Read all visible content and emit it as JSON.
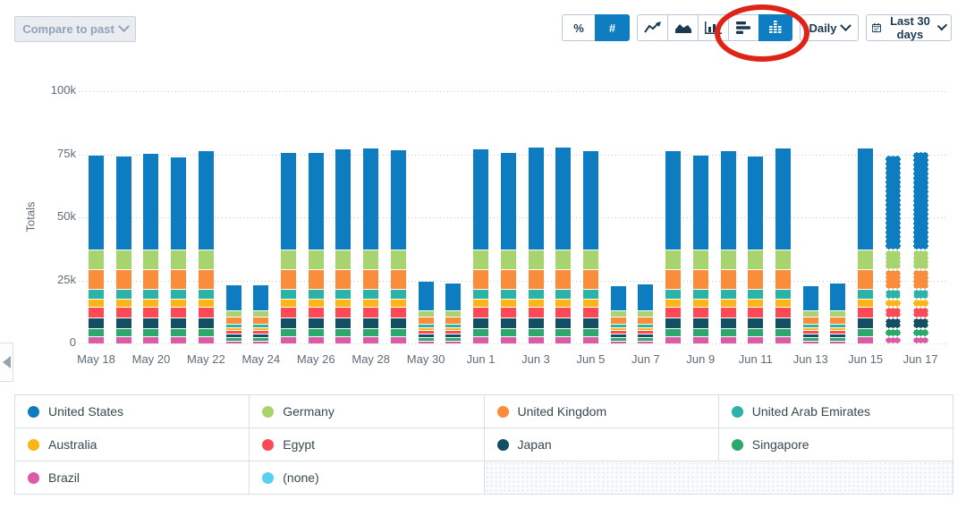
{
  "toolbar": {
    "compare_label": "Compare to past",
    "percent_label": "%",
    "count_label": "#",
    "selected_metric_view": "#",
    "chart_type_buttons": [
      "line-chart",
      "area-chart",
      "bar-chart",
      "horizontal-stacked-bar",
      "stacked-column"
    ],
    "selected_chart_type": "stacked-column",
    "interval_label": "Daily",
    "date_range_label": "Last 30 days",
    "accent_blue": "#0e7dc1",
    "icon_color": "#1b3a52"
  },
  "annotation": {
    "shape": "ellipse",
    "color": "#e02317",
    "target": "stacked-column-button"
  },
  "chart_data": {
    "type": "bar",
    "stacked": true,
    "ylabel": "Totals",
    "unit": "thousands",
    "ylim": [
      0,
      100
    ],
    "ytick_labels_top_down": [
      "100k",
      "75k",
      "50k",
      "25k",
      "0"
    ],
    "grid": "dotted-horizontal",
    "legend_position": "bottom-table",
    "x_label_every": 2,
    "dashed_indices": [
      29,
      30
    ],
    "categories": [
      "May 18",
      "May 19",
      "May 20",
      "May 21",
      "May 22",
      "May 23",
      "May 24",
      "May 25",
      "May 26",
      "May 27",
      "May 28",
      "May 29",
      "May 30",
      "May 31",
      "Jun 1",
      "Jun 2",
      "Jun 3",
      "Jun 4",
      "Jun 5",
      "Jun 6",
      "Jun 7",
      "Jun 8",
      "Jun 9",
      "Jun 10",
      "Jun 11",
      "Jun 12",
      "Jun 13",
      "Jun 14",
      "Jun 15",
      "Jun 16",
      "Jun 17"
    ],
    "series": [
      {
        "name": "United States",
        "color": "#0d7cc1",
        "values": [
          37.4,
          37.1,
          38.1,
          36.8,
          39.4,
          10.4,
          10.4,
          38.6,
          38.5,
          39.9,
          40.3,
          39.7,
          11.6,
          11.1,
          40.0,
          38.5,
          40.8,
          40.5,
          39.3,
          10.0,
          10.5,
          39.1,
          37.6,
          39.3,
          37.2,
          40.2,
          9.8,
          11.0,
          40.2,
          37.6,
          38.9
        ]
      },
      {
        "name": "Germany",
        "color": "#a8d46f",
        "values": [
          8,
          8,
          8,
          8,
          8,
          2.7,
          2.7,
          8,
          8,
          8,
          8,
          8,
          2.7,
          2.7,
          8,
          8,
          8,
          8,
          8,
          2.7,
          2.7,
          8,
          8,
          8,
          8,
          8,
          2.7,
          2.7,
          8,
          8,
          8
        ]
      },
      {
        "name": "United Kingdom",
        "color": "#f98d3c",
        "values": [
          7.7,
          7.7,
          7.7,
          7.7,
          7.7,
          2.8,
          2.8,
          7.7,
          7.7,
          7.7,
          7.7,
          7.7,
          2.8,
          2.8,
          7.7,
          7.7,
          7.7,
          7.7,
          7.7,
          2.8,
          2.8,
          7.7,
          7.7,
          7.7,
          7.7,
          7.7,
          2.8,
          2.8,
          7.7,
          7.7,
          7.7
        ]
      },
      {
        "name": "United Arab Emirates",
        "color": "#2bb3a8",
        "values": [
          3.8,
          3.8,
          3.8,
          3.8,
          3.8,
          1.3,
          1.3,
          3.8,
          3.8,
          3.8,
          3.8,
          3.8,
          1.3,
          1.3,
          3.8,
          3.8,
          3.8,
          3.8,
          3.8,
          1.3,
          1.3,
          3.8,
          3.8,
          3.8,
          3.8,
          3.8,
          1.3,
          1.3,
          3.8,
          3.8,
          3.8
        ]
      },
      {
        "name": "Australia",
        "color": "#fdb515",
        "values": [
          3.5,
          3.5,
          3.5,
          3.5,
          3.5,
          1.1,
          1.1,
          3.5,
          3.5,
          3.5,
          3.5,
          3.5,
          1.1,
          1.1,
          3.5,
          3.5,
          3.5,
          3.5,
          3.5,
          1.1,
          1.1,
          3.5,
          3.5,
          3.5,
          3.5,
          3.5,
          1.1,
          1.1,
          3.5,
          3.5,
          3.5
        ]
      },
      {
        "name": "Egypt",
        "color": "#fb4a55",
        "values": [
          4.2,
          4.2,
          4.2,
          4.2,
          4.2,
          1.3,
          1.3,
          4.2,
          4.2,
          4.2,
          4.2,
          4.2,
          1.3,
          1.3,
          4.2,
          4.2,
          4.2,
          4.2,
          4.2,
          1.3,
          1.3,
          4.2,
          4.2,
          4.2,
          4.2,
          4.2,
          1.3,
          1.3,
          4.2,
          4.2,
          4.2
        ]
      },
      {
        "name": "Japan",
        "color": "#124f62",
        "values": [
          4.0,
          4.0,
          4.0,
          4.0,
          4.0,
          1.6,
          1.6,
          4.0,
          4.0,
          4.0,
          4.0,
          4.0,
          1.6,
          1.6,
          4.0,
          4.0,
          4.0,
          4.0,
          4.0,
          1.6,
          1.6,
          4.0,
          4.0,
          4.0,
          4.0,
          4.0,
          1.6,
          1.6,
          4.0,
          4.0,
          4.0
        ]
      },
      {
        "name": "Singapore",
        "color": "#2ba96a",
        "values": [
          3.3,
          3.3,
          3.3,
          3.3,
          3.3,
          1.3,
          1.3,
          3.3,
          3.3,
          3.3,
          3.3,
          3.3,
          1.3,
          1.3,
          3.3,
          3.3,
          3.3,
          3.3,
          3.3,
          1.3,
          1.3,
          3.3,
          3.3,
          3.3,
          3.3,
          3.3,
          1.3,
          1.3,
          3.3,
          3.3,
          3.3
        ]
      },
      {
        "name": "Brazil",
        "color": "#dd5ba6",
        "values": [
          2.9,
          2.9,
          2.9,
          2.9,
          2.9,
          1.1,
          1.1,
          2.9,
          2.9,
          2.9,
          2.9,
          2.9,
          1.1,
          1.1,
          2.9,
          2.9,
          2.9,
          2.9,
          2.9,
          1.1,
          1.1,
          2.9,
          2.9,
          2.9,
          2.9,
          2.9,
          1.1,
          1.1,
          2.9,
          2.9,
          2.9
        ]
      },
      {
        "name": "(none)",
        "color": "#55d1f2",
        "values": [
          0,
          0,
          0,
          0,
          0,
          0,
          0,
          0,
          0,
          0,
          0,
          0,
          0,
          0,
          0,
          0,
          0,
          0,
          0,
          0,
          0,
          0,
          0,
          0,
          0,
          0,
          0,
          0,
          0,
          0,
          0
        ]
      }
    ]
  }
}
